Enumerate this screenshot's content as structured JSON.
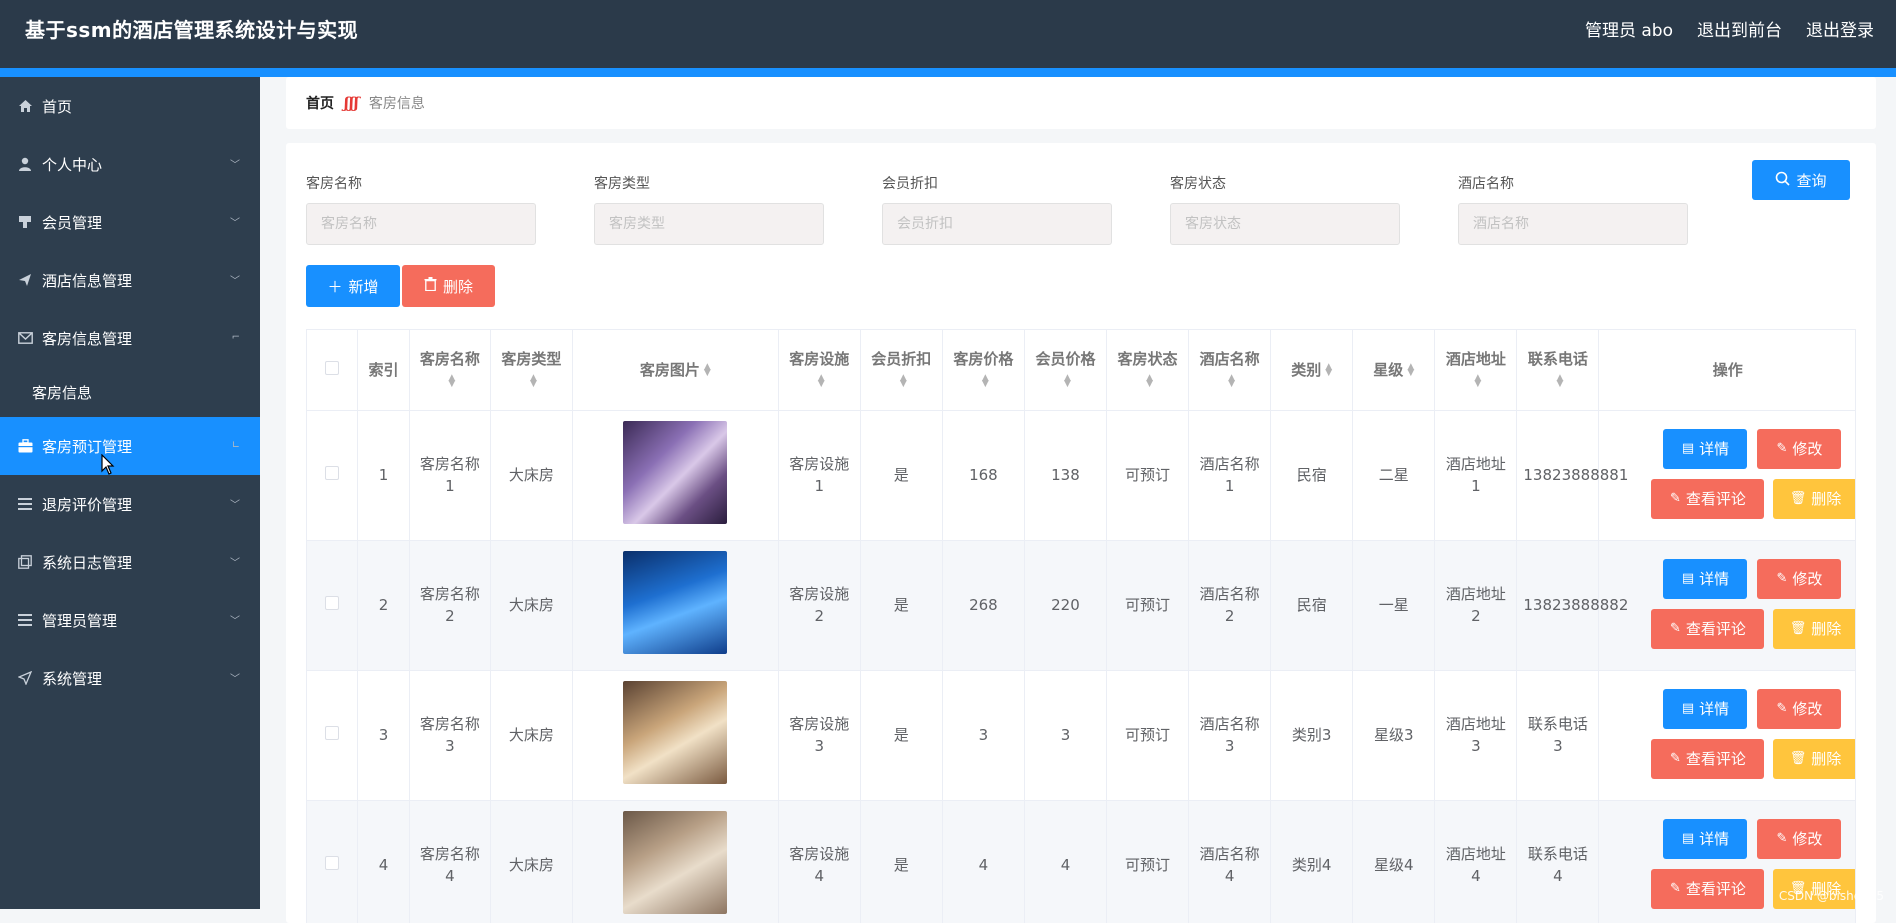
{
  "app": {
    "title": "基于ssm的酒店管理系统设计与实现",
    "user_label": "管理员 abo",
    "to_frontend": "退出到前台",
    "logout": "退出登录"
  },
  "colors": {
    "topbar": "#2b3a4a",
    "sidebar": "#2e3e4e",
    "accent": "#1890ff",
    "danger": "#f56c5c",
    "warning": "#ffc53d"
  },
  "sidebar": {
    "items": [
      {
        "label": "首页",
        "icon": "home-icon"
      },
      {
        "label": "个人中心",
        "icon": "user-icon"
      },
      {
        "label": "会员管理",
        "icon": "stamp-icon"
      },
      {
        "label": "酒店信息管理",
        "icon": "send-icon"
      },
      {
        "label": "客房信息管理",
        "icon": "mail-icon",
        "sub": [
          "客房信息"
        ]
      },
      {
        "label": "客房预订管理",
        "icon": "suitcase-icon",
        "active": true
      },
      {
        "label": "退房评价管理",
        "icon": "list-icon"
      },
      {
        "label": "系统日志管理",
        "icon": "copy-icon"
      },
      {
        "label": "管理员管理",
        "icon": "list-icon"
      },
      {
        "label": "系统管理",
        "icon": "navigation-icon"
      }
    ]
  },
  "breadcrumb": {
    "home": "首页",
    "separator": "ʃʃʃ",
    "current": "客房信息"
  },
  "filters": [
    {
      "label": "客房名称",
      "placeholder": "客房名称"
    },
    {
      "label": "客房类型",
      "placeholder": "客房类型"
    },
    {
      "label": "会员折扣",
      "placeholder": "会员折扣"
    },
    {
      "label": "客房状态",
      "placeholder": "客房状态"
    },
    {
      "label": "酒店名称",
      "placeholder": "酒店名称"
    }
  ],
  "buttons": {
    "query": "查询",
    "add": "新增",
    "delete_batch": "删除"
  },
  "table": {
    "headers": [
      "索引",
      "客房名称",
      "客房类型",
      "客房图片",
      "客房设施",
      "会员折扣",
      "客房价格",
      "会员价格",
      "客房状态",
      "酒店名称",
      "类别",
      "星级",
      "酒店地址",
      "联系电话",
      "操作"
    ],
    "row_ops": {
      "detail": "详情",
      "edit": "修改",
      "comments": "查看评论",
      "delete": "删除"
    },
    "rows": [
      {
        "index": "1",
        "name": "客房名称1",
        "type": "大床房",
        "facility": "客房设施1",
        "discount": "是",
        "price": "168",
        "member_price": "138",
        "status": "可预订",
        "hotel": "酒店名称1",
        "category": "民宿",
        "stars": "二星",
        "address": "酒店地址1",
        "phone": "13823888881",
        "thumb": "purple-room"
      },
      {
        "index": "2",
        "name": "客房名称2",
        "type": "大床房",
        "facility": "客房设施2",
        "discount": "是",
        "price": "268",
        "member_price": "220",
        "status": "可预订",
        "hotel": "酒店名称2",
        "category": "民宿",
        "stars": "一星",
        "address": "酒店地址2",
        "phone": "13823888882",
        "thumb": "aquarium-room"
      },
      {
        "index": "3",
        "name": "客房名称3",
        "type": "大床房",
        "facility": "客房设施3",
        "discount": "是",
        "price": "3",
        "member_price": "3",
        "status": "可预订",
        "hotel": "酒店名称3",
        "category": "类别3",
        "stars": "星级3",
        "address": "酒店地址3",
        "phone": "联系电话3",
        "thumb": "warm-room"
      },
      {
        "index": "4",
        "name": "客房名称4",
        "type": "大床房",
        "facility": "客房设施4",
        "discount": "是",
        "price": "4",
        "member_price": "4",
        "status": "可预订",
        "hotel": "酒店名称4",
        "category": "类别4",
        "stars": "星级4",
        "address": "酒店地址4",
        "phone": "联系电话4",
        "thumb": "beige-room"
      }
    ]
  },
  "watermark": "CSDN @bishe905"
}
